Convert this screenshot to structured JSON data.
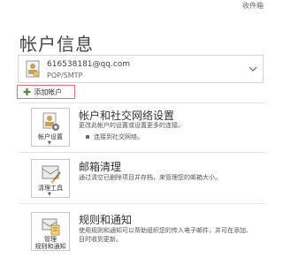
{
  "topbar": {
    "inbox_label": "收件箱"
  },
  "title": "帐户信息",
  "account": {
    "email": "616538181@qq.com",
    "type": "POP/SMTP"
  },
  "add_account": {
    "label": "添加帐户"
  },
  "sections": [
    {
      "tile_lines": [
        "帐户设置"
      ],
      "title": "帐户和社交网络设置",
      "desc_lines": [
        "更改此帐户的设置或设置更多的连接。"
      ],
      "bullet": "连接到社交网络。"
    },
    {
      "tile_lines": [
        "清理工具"
      ],
      "title": "邮箱清理",
      "desc_lines": [
        "通过清空已删除项目并存档，来管理您的邮箱大小。"
      ]
    },
    {
      "tile_lines": [
        "管理",
        "规则和通知"
      ],
      "title": "规则和通知",
      "desc_lines": [
        "使用规则和通知可以帮助组织您的传入电子邮件，并可在添加、",
        "目时收到更新。"
      ]
    }
  ]
}
